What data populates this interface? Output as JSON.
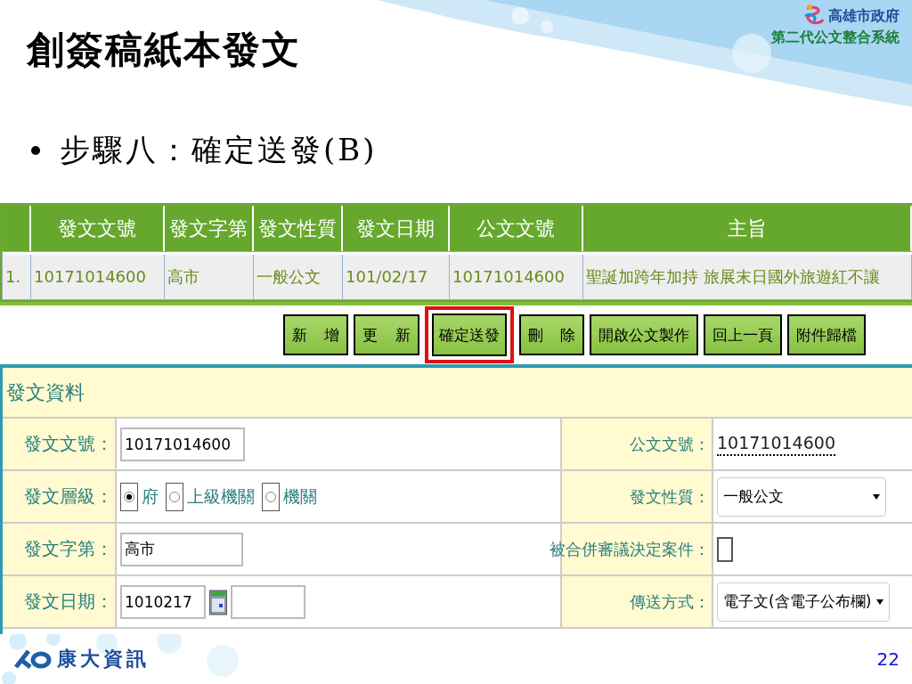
{
  "slide": {
    "title": "創簽稿紙本發文",
    "bullet": "步驟八：確定送發(B)",
    "logo_name": "高雄市政府",
    "logo_system": "第二代公文整合系統",
    "footer_logo": "康大資訊",
    "page_number": "22"
  },
  "list_table": {
    "columns": [
      "發文文號",
      "發文字第",
      "發文性質",
      "發文日期",
      "公文文號",
      "主旨"
    ],
    "rows": [
      {
        "index": "1.",
        "cells": [
          "10171014600",
          "高市",
          "一般公文",
          "101/02/17",
          "10171014600",
          "聖誕加跨年加持 旅展末日國外旅遊紅不讓"
        ]
      }
    ]
  },
  "buttons": [
    {
      "label": "新 增",
      "highlighted": false
    },
    {
      "label": "更 新",
      "highlighted": false
    },
    {
      "label": "確定送發",
      "highlighted": true
    },
    {
      "label": "刪 除",
      "highlighted": false
    },
    {
      "label": "開啟公文製作",
      "highlighted": false
    },
    {
      "label": "回上一頁",
      "highlighted": false
    },
    {
      "label": "附件歸檔",
      "highlighted": false
    }
  ],
  "form": {
    "title": "發文資料",
    "rows": [
      {
        "left": {
          "label": "發文文號：",
          "kind": "input",
          "value": "10171014600"
        },
        "right": {
          "label": "公文文號：",
          "kind": "text",
          "value": "10171014600"
        }
      },
      {
        "left": {
          "label": "發文層級：",
          "kind": "radios",
          "options": [
            {
              "label": "府",
              "selected": true
            },
            {
              "label": "上級機關",
              "selected": false
            },
            {
              "label": "機關",
              "selected": false
            }
          ]
        },
        "right": {
          "label": "發文性質：",
          "kind": "select",
          "value": "一般公文"
        }
      },
      {
        "left": {
          "label": "發文字第：",
          "kind": "input",
          "value": "高市"
        },
        "right": {
          "label": "被合併審議決定案件：",
          "kind": "checkbox",
          "checked": false
        }
      },
      {
        "left": {
          "label": "發文日期：",
          "kind": "date",
          "value": "1010217"
        },
        "right": {
          "label": "傳送方式：",
          "kind": "select",
          "value": "電子文(含電子公布欄)"
        }
      }
    ]
  }
}
